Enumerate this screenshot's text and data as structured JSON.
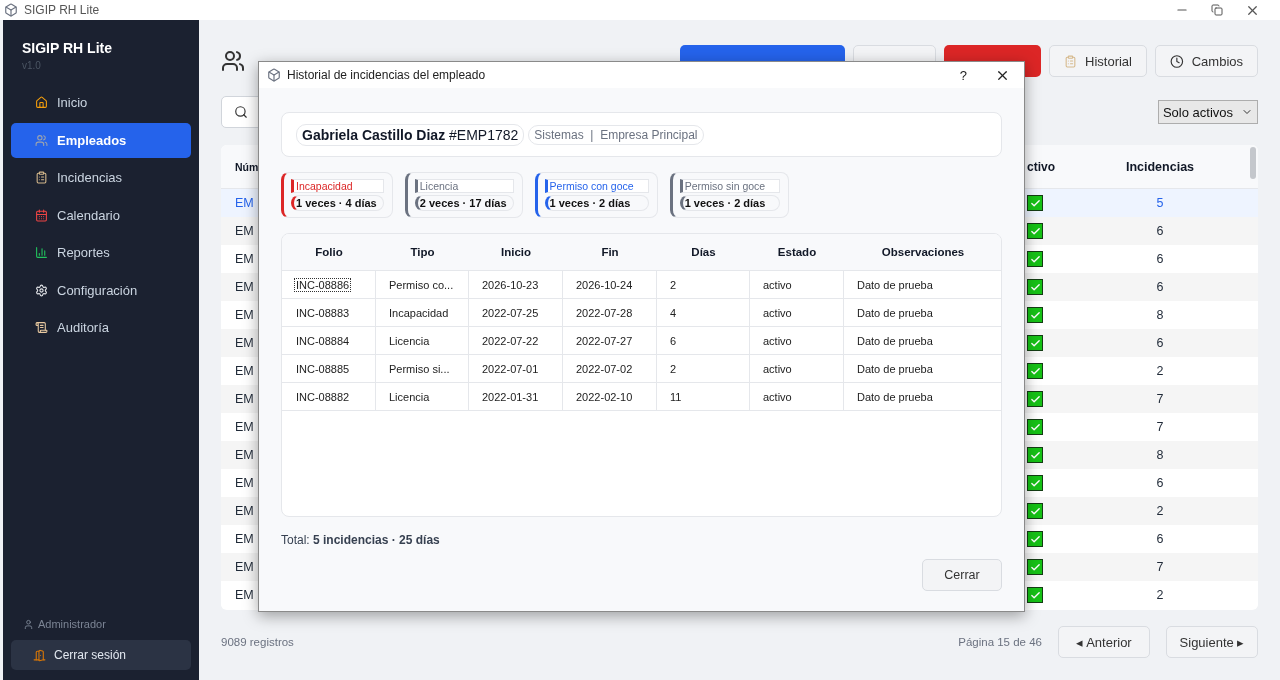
{
  "window": {
    "title": "SIGIP RH Lite"
  },
  "sidebar": {
    "app_name": "SIGIP RH Lite",
    "version": "v1.0",
    "items": [
      {
        "label": "Inicio",
        "selected": false
      },
      {
        "label": "Empleados",
        "selected": true
      },
      {
        "label": "Incidencias",
        "selected": false
      },
      {
        "label": "Calendario",
        "selected": false
      },
      {
        "label": "Reportes",
        "selected": false
      },
      {
        "label": "Configuración",
        "selected": false
      },
      {
        "label": "Auditoría",
        "selected": false
      }
    ],
    "user": "Administrador",
    "logout": "Cerrar sesión"
  },
  "toolbar": {
    "buttons": [
      {
        "kind": "primary"
      },
      {
        "kind": "plain"
      },
      {
        "kind": "danger"
      },
      {
        "kind": "plain",
        "label": "Historial"
      },
      {
        "kind": "plain",
        "label": "Cambios"
      }
    ]
  },
  "filter": {
    "value": "Solo activos"
  },
  "table": {
    "columns": [
      "Núm",
      "ctivo",
      "Incidencias"
    ],
    "rows": [
      {
        "num": "EM",
        "active": true,
        "incidencias": "5",
        "selected": true
      },
      {
        "num": "EM",
        "active": true,
        "incidencias": "6",
        "selected": false
      },
      {
        "num": "EM",
        "active": true,
        "incidencias": "6",
        "selected": false
      },
      {
        "num": "EM",
        "active": true,
        "incidencias": "6",
        "selected": false
      },
      {
        "num": "EM",
        "active": true,
        "incidencias": "8",
        "selected": false
      },
      {
        "num": "EM",
        "active": true,
        "incidencias": "6",
        "selected": false
      },
      {
        "num": "EM",
        "active": true,
        "incidencias": "2",
        "selected": false
      },
      {
        "num": "EM",
        "active": true,
        "incidencias": "7",
        "selected": false
      },
      {
        "num": "EM",
        "active": true,
        "incidencias": "7",
        "selected": false
      },
      {
        "num": "EM",
        "active": true,
        "incidencias": "8",
        "selected": false
      },
      {
        "num": "EM",
        "active": true,
        "incidencias": "6",
        "selected": false
      },
      {
        "num": "EM",
        "active": true,
        "incidencias": "2",
        "selected": false
      },
      {
        "num": "EM",
        "active": true,
        "incidencias": "6",
        "selected": false
      },
      {
        "num": "EM",
        "active": true,
        "incidencias": "7",
        "selected": false
      },
      {
        "num": "EM",
        "active": true,
        "incidencias": "2",
        "selected": false
      }
    ]
  },
  "footer": {
    "count": "9089 registros",
    "page": "Página 15 de 46",
    "prev": "◂ Anterior",
    "next": "Siguiente ▸"
  },
  "dialog": {
    "title": "Historial de incidencias del empleado",
    "help": "?",
    "employee": {
      "name": "**Gabriela Castillo Diaz** #EMP1782",
      "department": "Sistemas  |  Empresa Principal"
    },
    "summary": [
      {
        "type": "Incapacidad",
        "count": "1 veces · 4 días",
        "color": "#dc2626"
      },
      {
        "type": "Licencia",
        "count": "2 veces · 17 días",
        "color": "#6b7280"
      },
      {
        "type": "Permiso con goce",
        "count": "1 veces · 2 días",
        "color": "#2563eb"
      },
      {
        "type": "Permiso sin goce",
        "count": "1 veces · 2 días",
        "color": "#6b7280"
      }
    ],
    "columns": [
      "Folio",
      "Tipo",
      "Inicio",
      "Fin",
      "Días",
      "Estado",
      "Observaciones"
    ],
    "rows": [
      {
        "cells": [
          "INC-08886",
          "Permiso co...",
          "2026-10-23",
          "2026-10-24",
          "2",
          "activo",
          "Dato de prueba"
        ],
        "focused": true
      },
      {
        "cells": [
          "INC-08883",
          "Incapacidad",
          "2022-07-25",
          "2022-07-28",
          "4",
          "activo",
          "Dato de prueba"
        ],
        "focused": false
      },
      {
        "cells": [
          "INC-08884",
          "Licencia",
          "2022-07-22",
          "2022-07-27",
          "6",
          "activo",
          "Dato de prueba"
        ],
        "focused": false
      },
      {
        "cells": [
          "INC-08885",
          "Permiso si...",
          "2022-07-01",
          "2022-07-02",
          "2",
          "activo",
          "Dato de prueba"
        ],
        "focused": false
      },
      {
        "cells": [
          "INC-08882",
          "Licencia",
          "2022-01-31",
          "2022-02-10",
          "11",
          "activo",
          "Dato de prueba"
        ],
        "focused": false
      }
    ],
    "total": "Total: **5 incidencias · 25 días**",
    "close_button": "Cerrar"
  }
}
